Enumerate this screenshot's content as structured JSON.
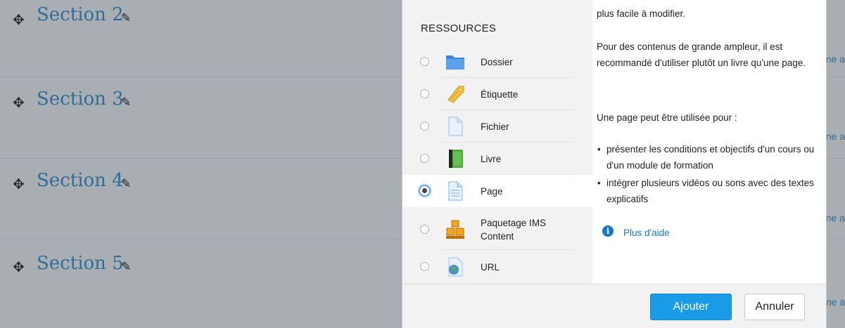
{
  "sections": [
    {
      "title": "Section 2",
      "edge_text": "ne a"
    },
    {
      "title": "Section 3",
      "edge_text": "ne a"
    },
    {
      "title": "Section 4",
      "edge_text": "ne a"
    },
    {
      "title": "Section 5",
      "edge_text": "ne a"
    }
  ],
  "chooser": {
    "header": "RESSOURCES",
    "items": [
      {
        "label": "Dossier",
        "icon": "folder-icon",
        "selected": false
      },
      {
        "label": "Étiquette",
        "icon": "label-tag-icon",
        "selected": false
      },
      {
        "label": "Fichier",
        "icon": "file-icon",
        "selected": false
      },
      {
        "label": "Livre",
        "icon": "book-icon",
        "selected": false
      },
      {
        "label": "Page",
        "icon": "page-icon",
        "selected": true
      },
      {
        "label": "Paquetage IMS Content",
        "icon": "ims-package-icon",
        "selected": false
      },
      {
        "label": "URL",
        "icon": "url-icon",
        "selected": false
      }
    ],
    "help": {
      "intro_end": "plus facile à modifier.",
      "para1": "Pour des contenus de grande ampleur, il est recommandé d'utiliser plutôt un livre qu'une page.",
      "para2": "Une page peut être utilisée pour :",
      "bullets": [
        "présenter les conditions et objectifs d'un cours ou d'un module de formation",
        "intégrer plusieurs vidéos ou sons avec des textes explicatifs"
      ],
      "more_help": "Plus d'aide"
    },
    "buttons": {
      "add": "Ajouter",
      "cancel": "Annuler"
    }
  },
  "colors": {
    "primary": "#1a9be6",
    "link": "#1177d1",
    "section_title": "#2f6e99"
  }
}
